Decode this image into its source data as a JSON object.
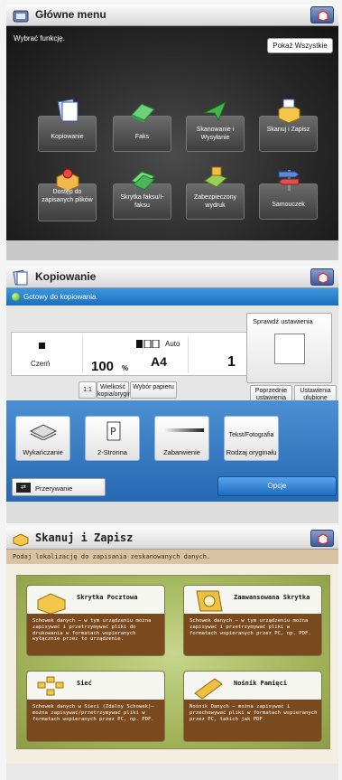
{
  "main_menu": {
    "title": "Główne menu",
    "prompt": "Wybrać funkcję.",
    "show_all": "Pokaż Wszystkie",
    "functions": [
      {
        "label": "Kopiowanie"
      },
      {
        "label": "Faks"
      },
      {
        "label": "Skanowanie i Wysyłanie"
      },
      {
        "label": "Skanuj i Zapisz"
      },
      {
        "label": "Dostęp do zapisanych plików"
      },
      {
        "label": "Skrytka faksu/I-faksu"
      },
      {
        "label": "Zabezpieczony wydruk"
      },
      {
        "label": "Samouczek"
      }
    ]
  },
  "copy": {
    "title": "Kopiowanie",
    "status": "Gotowy do kopiowania.",
    "color_mode": "Czerń",
    "zoom": "100",
    "zoom_unit": "%",
    "paper_auto": "Auto",
    "paper_size": "A4",
    "copies": "1",
    "ratio_label": "1:1",
    "buttons": {
      "copy_ratio": "Wielkość kopia/oryginał",
      "paper_select": "Wybór papieru",
      "check_settings": "Sprawdź ustawienia",
      "previous_settings": "Poprzednie ustawienia",
      "favorites": "Ustawienia ulubione",
      "finishing": "Wykańczanie",
      "two_sided": "2-Stronna",
      "density": "Zabarwienie",
      "original_type_value": "Tekst/Fotografia",
      "original_type": "Rodzaj oryginału",
      "interrupt": "Przerywanie",
      "options": "Opcje"
    }
  },
  "scan_store": {
    "title": "Skanuj i Zapisz",
    "instruction": "Podaj lokalizację do zapisania zeskanowanych danych.",
    "locations": [
      {
        "title": "Skrytka Pocztowa",
        "desc": "Schowek danych – w tym urządzeniu można zapisywać i przetrzymywać pliki do drukowania w formatach wspieranych wyłącznie przez to urządzenie."
      },
      {
        "title": "Zaawansowana Skrytka",
        "desc": "Schowek danych – w tym urządzeniu można zapisywać i przetrzymywać pliki w formatach wspieranych przez PC, np. PDF."
      },
      {
        "title": "Sieć",
        "desc": "Schowek danych w Sieci (Zdalny Schowek)– można zapisywać/przetrzymywać pliki w formatach wspieranych przez PC, np. PDF."
      },
      {
        "title": "Nośnik Pamięci",
        "desc": "Nośnik Danych – można zapisywać i przechowywać pliki w formatach wspieranych przez PC, takich jak PDF."
      }
    ]
  },
  "colors": {
    "accent_blue": "#2668b2",
    "status_green": "#3c9a18",
    "scan_green": "#a3b55a",
    "scan_brown": "#7a4a1e"
  }
}
